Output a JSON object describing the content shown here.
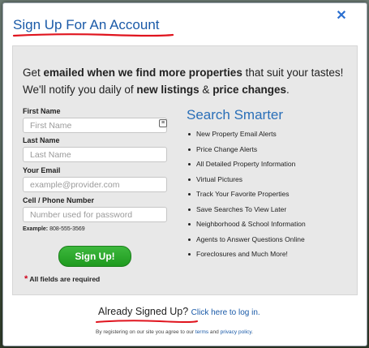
{
  "modal": {
    "title": "Sign Up For An Account",
    "close_glyph": "✕"
  },
  "intro": {
    "part1": "Get ",
    "bold1": "emailed when we find more properties",
    "part2": " that suit your tastes! We'll notify you daily of ",
    "bold2": "new listings",
    "part3": " & ",
    "bold3": "price changes",
    "part4": "."
  },
  "form": {
    "first_name": {
      "label": "First Name",
      "placeholder": "First Name",
      "value": ""
    },
    "last_name": {
      "label": "Last Name",
      "placeholder": "Last Name",
      "value": ""
    },
    "email": {
      "label": "Your Email",
      "placeholder": "example@provider.com",
      "value": ""
    },
    "phone": {
      "label": "Cell / Phone Number",
      "placeholder": "Number used for password",
      "value": ""
    },
    "example_label": "Example:",
    "example_value": "808-555-3569",
    "submit_label": "Sign Up!",
    "required_star": "*",
    "required_text": "All fields are required"
  },
  "smarter": {
    "title": "Search Smarter",
    "items": [
      "New Property Email Alerts",
      "Price Change Alerts",
      "All Detailed Property Information",
      "Virtual Pictures",
      "Track Your Favorite Properties",
      "Save Searches To View Later",
      "Neighborhood & School Information",
      "Agents to Answer Questions Online",
      "Foreclosures and Much More!"
    ]
  },
  "footer": {
    "already_text": "Already Signed Up?",
    "login_link": "Click here to log in.",
    "legal_prefix": "By registering on our site you agree to our ",
    "terms_link": "terms",
    "legal_and": " and ",
    "privacy_link": "privacy policy",
    "legal_suffix": "."
  },
  "colors": {
    "accent_blue": "#1a5aa8",
    "underline_red": "#e0141e",
    "button_green": "#2aa82a"
  },
  "icons": {
    "close": "close-icon",
    "autofill": "contact-card-icon"
  }
}
